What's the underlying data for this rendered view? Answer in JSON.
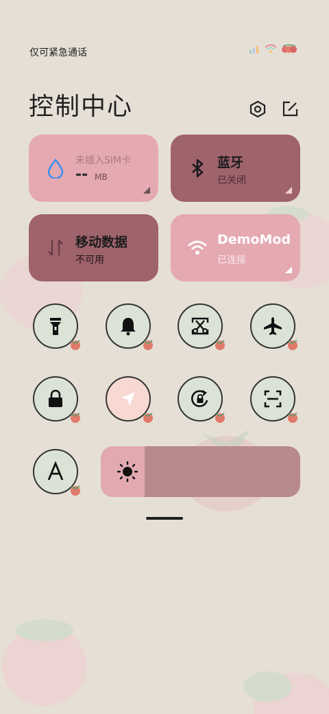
{
  "status": {
    "carrier_text": "仅可紧急通话"
  },
  "header": {
    "title": "控制中心"
  },
  "tiles": {
    "sim": {
      "title": "未插入SIM卡",
      "value": "--",
      "unit": "MB"
    },
    "bluetooth": {
      "title": "蓝牙",
      "status": "已关闭"
    },
    "mobile_data": {
      "title": "移动数据",
      "status": "不可用"
    },
    "wifi": {
      "title": "DemoMod",
      "status": "已连接"
    }
  },
  "toggles": [
    {
      "icon": "flashlight-icon",
      "active": false
    },
    {
      "icon": "bell-icon",
      "active": false
    },
    {
      "icon": "screenshot-icon",
      "active": false
    },
    {
      "icon": "airplane-icon",
      "active": false
    },
    {
      "icon": "lock-icon",
      "active": false
    },
    {
      "icon": "location-icon",
      "active": true
    },
    {
      "icon": "rotation-lock-icon",
      "active": false
    },
    {
      "icon": "scan-icon",
      "active": false
    },
    {
      "icon": "font-icon",
      "active": false
    }
  ],
  "brightness": {
    "level": 0.22
  },
  "colors": {
    "tile_light": "#e5a9b1",
    "tile_dark": "#9f636c",
    "toggle_bg": "#dbe3d7",
    "background": "#e6dfd6"
  }
}
